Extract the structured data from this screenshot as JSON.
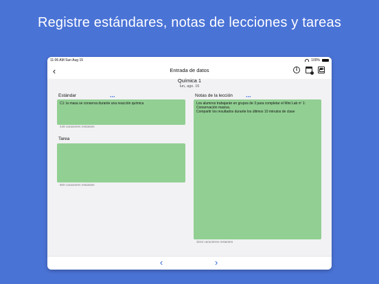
{
  "headline": "Registre estándares, notas de lecciones y tareas",
  "statusbar": {
    "time": "11:06 AM  Sun Aug 15",
    "battery": "100%"
  },
  "navbar": {
    "title": "Entrada de datos"
  },
  "header": {
    "class_name": "Química 1",
    "date": "lun, ago. 16"
  },
  "standards": {
    "label": "Estándar",
    "text": "C1: la masa se conserva durante una reacción química",
    "counter": "448 caracteres restantes"
  },
  "homework": {
    "label": "Tarea",
    "text": "",
    "counter": "500 caracteres restantes"
  },
  "lesson_notes": {
    "label": "Notas de la lección",
    "text": "Los alumnos trabajarán en grupos de 3 para completar el Mini Lab nº 1: Conservación masiva.\nCompartir los resultados durante los últimos 10 minutos de clase",
    "counter": "3244 caracteres restantes"
  },
  "icons": {
    "back": "chevron-left-icon",
    "info": "info-icon",
    "calendar": "calendar-icon",
    "save": "save-icon",
    "more": "more-horizontal-icon",
    "prev": "chevron-left-icon",
    "next": "chevron-right-icon"
  },
  "colors": {
    "background": "#4a73d6",
    "note_fill": "#92cf93",
    "accent": "#2b5fd9"
  }
}
